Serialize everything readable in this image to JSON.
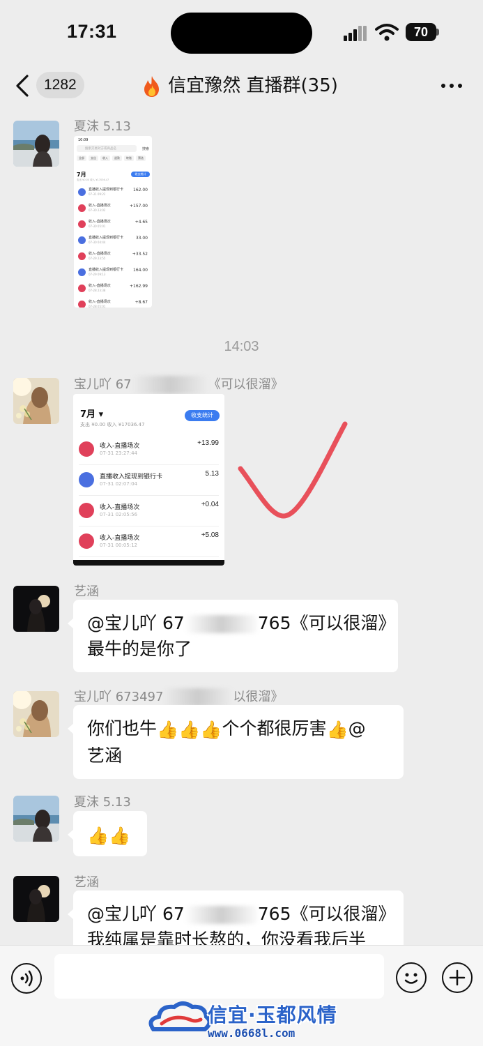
{
  "status": {
    "time": "17:31",
    "battery": "70"
  },
  "nav": {
    "back_count": "1282",
    "title": "信宜豫然 直播群(35)",
    "title_icon": "flame-icon"
  },
  "messages": {
    "m1": {
      "sender": "夏沫 5.13",
      "type": "image",
      "shot": {
        "status_time": "10:09",
        "search_placeholder": "搜索交易对方或商品名",
        "search_action": "搜索",
        "filters": [
          "全部",
          "支出",
          "收入",
          "退款",
          "转账",
          "筛选"
        ],
        "month": "7月",
        "summary": "支出 ¥0.00  收入 ¥17036.47",
        "stats_btn": "收支统计",
        "rows": [
          {
            "title": "直播收入提现到银行卡",
            "sub": "07-31 09:22",
            "amount": "162.00",
            "icon": "bank"
          },
          {
            "title": "收入-直播场次",
            "sub": "07-30 23:02",
            "amount": "+157.00",
            "icon": "live"
          },
          {
            "title": "收入-直播场次",
            "sub": "07-30 05:01",
            "amount": "+4.65",
            "icon": "live"
          },
          {
            "title": "直播收入提现到银行卡",
            "sub": "07-30 04:44",
            "amount": "33.00",
            "icon": "bank"
          },
          {
            "title": "收入-直播场次",
            "sub": "07-29 23:55",
            "amount": "+33.52",
            "icon": "live"
          },
          {
            "title": "直播收入提现到银行卡",
            "sub": "07-29 09:13",
            "amount": "164.00",
            "icon": "bank"
          },
          {
            "title": "收入-直播场次",
            "sub": "07-28 23:38",
            "amount": "+162.99",
            "icon": "live"
          },
          {
            "title": "收入-直播场次",
            "sub": "07-28 05:01",
            "amount": "+8.67",
            "icon": "live"
          }
        ]
      }
    },
    "timestamp": "14:03",
    "m2": {
      "sender_prefix": "宝儿吖 67",
      "sender_suffix": "《可以很溜》",
      "type": "image",
      "shot": {
        "month": "7月",
        "summary": "支出 ¥0.00    收入 ¥17036.47",
        "stats_btn": "收支统计",
        "rows": [
          {
            "title": "收入-直播场次",
            "sub": "07-31 23:27:44",
            "amount": "+13.99",
            "icon": "live"
          },
          {
            "title": "直播收入提现到银行卡",
            "sub": "07-31 02:07:04",
            "amount": "5.13",
            "icon": "bank"
          },
          {
            "title": "收入-直播场次",
            "sub": "07-31 02:05:56",
            "amount": "+0.04",
            "icon": "live"
          },
          {
            "title": "收入-直播场次",
            "sub": "07-31 00:05:12",
            "amount": "+5.08",
            "icon": "live"
          }
        ]
      }
    },
    "m3": {
      "sender": "艺涵",
      "mention_prefix": "@宝儿吖 67",
      "mention_suffix": "765《可以很溜》",
      "line2": "最牛的是你了"
    },
    "m4": {
      "sender_prefix": "宝儿吖 673497",
      "sender_suffix": "以很溜》",
      "line1_a": "你们也牛",
      "line1_b": "个个都很厉害",
      "line1_c": "@",
      "line2": "艺涵",
      "emoji": "thumbs-up-icon"
    },
    "m5": {
      "sender": "夏沫 5.13",
      "emoji": "thumbs-up-icon"
    },
    "m6": {
      "sender": "艺涵",
      "mention_prefix": "@宝儿吖 67",
      "mention_suffix": "765《可以很溜》",
      "line2": "我纯属是靠时长熬的，你没看我后半"
    }
  },
  "input": {
    "placeholder": "",
    "voice_icon": "voice-icon",
    "emoji_icon": "smiley-icon",
    "plus_icon": "plus-icon"
  },
  "watermark": {
    "name": "信宜·玉都风情",
    "url": "www.0668l.com"
  },
  "colors": {
    "background": "#ededed",
    "bubble": "#ffffff",
    "accent_blue": "#3b7cf0",
    "live_icon": "#e0405a",
    "bank_icon": "#4a6fe0",
    "check_mark": "#e8505a"
  }
}
